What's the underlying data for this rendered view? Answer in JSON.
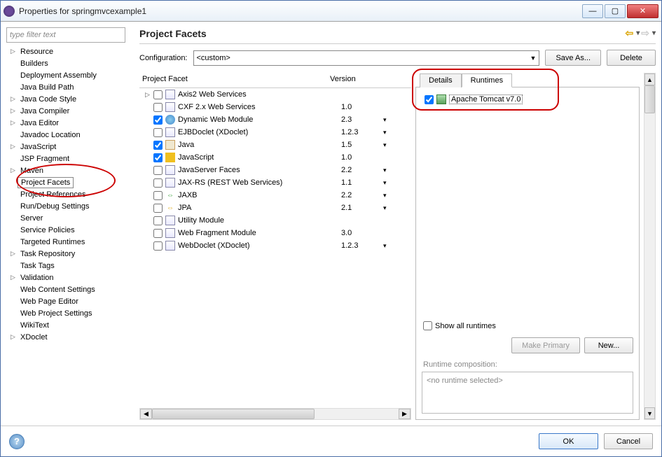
{
  "window": {
    "title": "Properties for springmvcexample1"
  },
  "filter_placeholder": "type filter text",
  "sidebar_items": [
    {
      "label": "Resource",
      "expandable": true
    },
    {
      "label": "Builders",
      "expandable": false
    },
    {
      "label": "Deployment Assembly",
      "expandable": false
    },
    {
      "label": "Java Build Path",
      "expandable": false
    },
    {
      "label": "Java Code Style",
      "expandable": true
    },
    {
      "label": "Java Compiler",
      "expandable": true
    },
    {
      "label": "Java Editor",
      "expandable": true
    },
    {
      "label": "Javadoc Location",
      "expandable": false
    },
    {
      "label": "JavaScript",
      "expandable": true
    },
    {
      "label": "JSP Fragment",
      "expandable": false
    },
    {
      "label": "Maven",
      "expandable": true
    },
    {
      "label": "Project Facets",
      "expandable": false,
      "selected": true
    },
    {
      "label": "Project References",
      "expandable": false
    },
    {
      "label": "Run/Debug Settings",
      "expandable": false
    },
    {
      "label": "Server",
      "expandable": false
    },
    {
      "label": "Service Policies",
      "expandable": false
    },
    {
      "label": "Targeted Runtimes",
      "expandable": false
    },
    {
      "label": "Task Repository",
      "expandable": true
    },
    {
      "label": "Task Tags",
      "expandable": false
    },
    {
      "label": "Validation",
      "expandable": true
    },
    {
      "label": "Web Content Settings",
      "expandable": false
    },
    {
      "label": "Web Page Editor",
      "expandable": false
    },
    {
      "label": "Web Project Settings",
      "expandable": false
    },
    {
      "label": "WikiText",
      "expandable": false
    },
    {
      "label": "XDoclet",
      "expandable": true
    }
  ],
  "content_title": "Project Facets",
  "config": {
    "label": "Configuration:",
    "value": "<custom>",
    "save_as": "Save As...",
    "delete_btn": "Delete"
  },
  "table_headers": {
    "facet": "Project Facet",
    "version": "Version"
  },
  "facets": [
    {
      "name": "Axis2 Web Services",
      "version": "",
      "checked": false,
      "expandable": true,
      "icon": "doc",
      "drop": false
    },
    {
      "name": "CXF 2.x Web Services",
      "version": "1.0",
      "checked": false,
      "expandable": false,
      "icon": "doc",
      "drop": false
    },
    {
      "name": "Dynamic Web Module",
      "version": "2.3",
      "checked": true,
      "expandable": false,
      "icon": "globe",
      "drop": true
    },
    {
      "name": "EJBDoclet (XDoclet)",
      "version": "1.2.3",
      "checked": false,
      "expandable": false,
      "icon": "doc",
      "drop": true
    },
    {
      "name": "Java",
      "version": "1.5",
      "checked": true,
      "expandable": false,
      "icon": "java",
      "drop": true
    },
    {
      "name": "JavaScript",
      "version": "1.0",
      "checked": true,
      "expandable": false,
      "icon": "js",
      "drop": false
    },
    {
      "name": "JavaServer Faces",
      "version": "2.2",
      "checked": false,
      "expandable": false,
      "icon": "doc",
      "drop": true
    },
    {
      "name": "JAX-RS (REST Web Services)",
      "version": "1.1",
      "checked": false,
      "expandable": false,
      "icon": "doc",
      "drop": true
    },
    {
      "name": "JAXB",
      "version": "2.2",
      "checked": false,
      "expandable": false,
      "icon": "arrow-g",
      "drop": true
    },
    {
      "name": "JPA",
      "version": "2.1",
      "checked": false,
      "expandable": false,
      "icon": "arrow-y",
      "drop": true
    },
    {
      "name": "Utility Module",
      "version": "",
      "checked": false,
      "expandable": false,
      "icon": "doc",
      "drop": false
    },
    {
      "name": "Web Fragment Module",
      "version": "3.0",
      "checked": false,
      "expandable": false,
      "icon": "doc",
      "drop": false
    },
    {
      "name": "WebDoclet (XDoclet)",
      "version": "1.2.3",
      "checked": false,
      "expandable": false,
      "icon": "doc",
      "drop": true
    }
  ],
  "tabs": {
    "details": "Details",
    "runtimes": "Runtimes"
  },
  "runtime": {
    "name": "Apache Tomcat v7.0",
    "checked": true
  },
  "show_all": "Show all runtimes",
  "make_primary": "Make Primary",
  "new_btn": "New...",
  "composition_label": "Runtime composition:",
  "composition_empty": "<no runtime selected>",
  "footer": {
    "ok": "OK",
    "cancel": "Cancel"
  }
}
